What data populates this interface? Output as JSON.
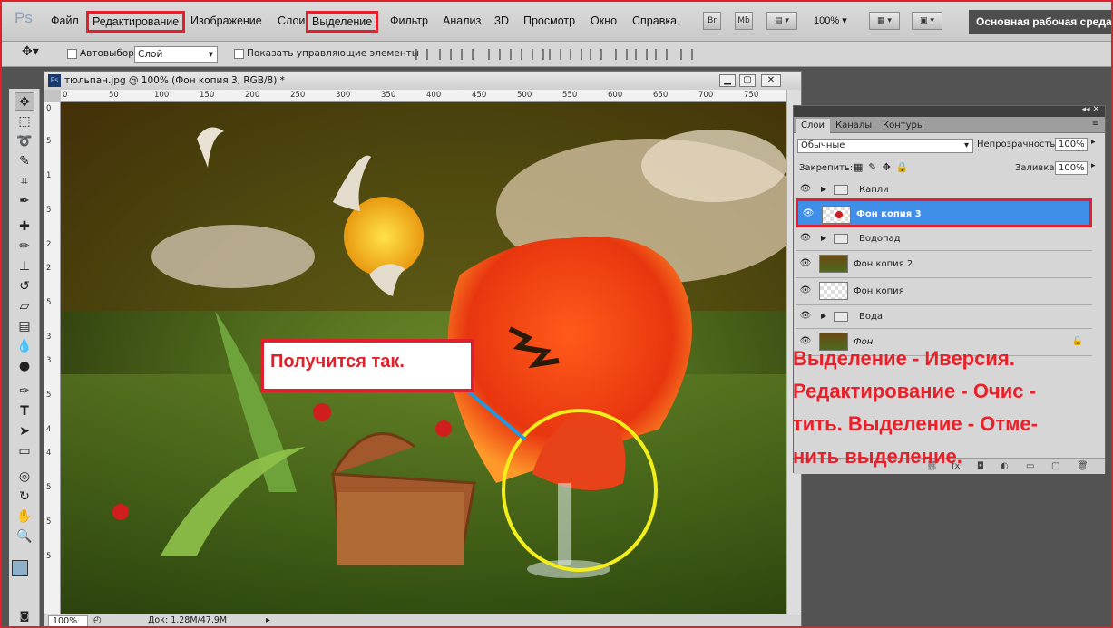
{
  "app": {
    "logo": "Ps"
  },
  "menu": {
    "items": [
      "Файл",
      "Редактирование",
      "Изображение",
      "Слои",
      "Выделение",
      "Фильтр",
      "Анализ",
      "3D",
      "Просмотр",
      "Окно",
      "Справка"
    ],
    "bridge": "Br",
    "minibridge": "Mb",
    "zoom": "100%",
    "workspace": "Основная рабочая среда"
  },
  "options": {
    "autoselect_label": "Автовыбор:",
    "autoselect_value": "Слой",
    "show_controls": "Показать управляющие элементы"
  },
  "document": {
    "title": "тюльпан.jpg @ 100% (Фон копия 3, RGB/8) *",
    "ruler_top": [
      "0",
      "50",
      "100",
      "150",
      "200",
      "250",
      "300",
      "350",
      "400",
      "450",
      "500",
      "550",
      "600",
      "650",
      "700",
      "750"
    ],
    "ruler_left": [
      "0",
      "5",
      "1",
      "5",
      "2",
      "2",
      "5",
      "3",
      "3",
      "5",
      "4",
      "4",
      "5",
      "5",
      "5"
    ],
    "zoom": "100%",
    "doc_info": "Док: 1,28M/47,9M"
  },
  "layers_panel": {
    "tabs": [
      "Слои",
      "Каналы",
      "Контуры"
    ],
    "blend_mode": "Обычные",
    "opacity_label": "Непрозрачность:",
    "opacity_value": "100%",
    "lock_label": "Закрепить:",
    "fill_label": "Заливка:",
    "fill_value": "100%",
    "layers": [
      {
        "name": "Капли",
        "type": "group"
      },
      {
        "name": "Фон копия 3",
        "type": "layer",
        "selected": true
      },
      {
        "name": "Водопад",
        "type": "group"
      },
      {
        "name": "Фон копия 2",
        "type": "layer"
      },
      {
        "name": "Фон копия",
        "type": "layer"
      },
      {
        "name": "Вода",
        "type": "group"
      },
      {
        "name": "Фон",
        "type": "layer",
        "locked": true
      }
    ]
  },
  "annotations": {
    "note": "Получится так.",
    "instructions": [
      "Выделение - Иверсия.",
      "Редактирование - Очис -",
      "тить. Выделение - Отме-",
      "нить выделение."
    ]
  },
  "colors": {
    "highlight": "#e0202a",
    "selection": "#3f8ee8",
    "circle": "#f2ee1a",
    "pointer": "#1f9ae0"
  }
}
